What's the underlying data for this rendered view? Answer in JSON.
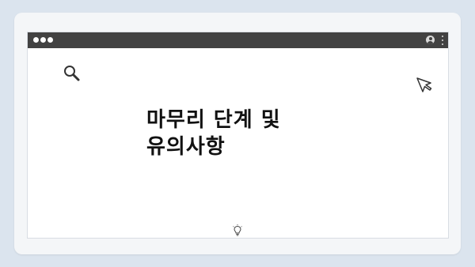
{
  "page": {
    "background_color": "#dbe4ee",
    "device_color": "#f4f6f8",
    "titlebar_color": "#424242"
  },
  "top_indicator": {
    "dot_count": 4
  },
  "window": {
    "titlebar": {
      "dots": 3,
      "icons": [
        "user-icon",
        "kebab-menu-icon"
      ]
    },
    "content": {
      "icons": [
        "search-icon",
        "cursor-icon",
        "lightbulb-icon"
      ],
      "title_line1": "마무리 단계 및",
      "title_line2": "유의사항"
    }
  }
}
